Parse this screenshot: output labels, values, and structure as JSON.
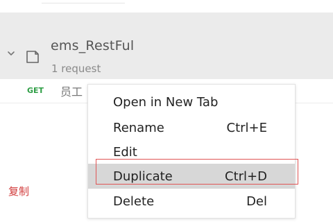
{
  "collection": {
    "name": "ems_RestFul",
    "count": "1 request",
    "chevron_icon": "chevron-down-icon",
    "folder_icon": "collection-folder-icon"
  },
  "request": {
    "method": "GET",
    "name_partial": "员工"
  },
  "annotation": {
    "text": "复制",
    "color": "#d23c3c"
  },
  "context_menu": {
    "items": [
      {
        "label": "Open in New Tab",
        "shortcut": ""
      },
      {
        "label": "Rename",
        "shortcut": "Ctrl+E"
      },
      {
        "label": "Edit",
        "shortcut": ""
      },
      {
        "label": "Duplicate",
        "shortcut": "Ctrl+D",
        "highlighted": true
      },
      {
        "label": "Delete",
        "shortcut": "Del"
      }
    ],
    "highlight_color": "#d7d7d7",
    "callout_color": "#e05555"
  }
}
